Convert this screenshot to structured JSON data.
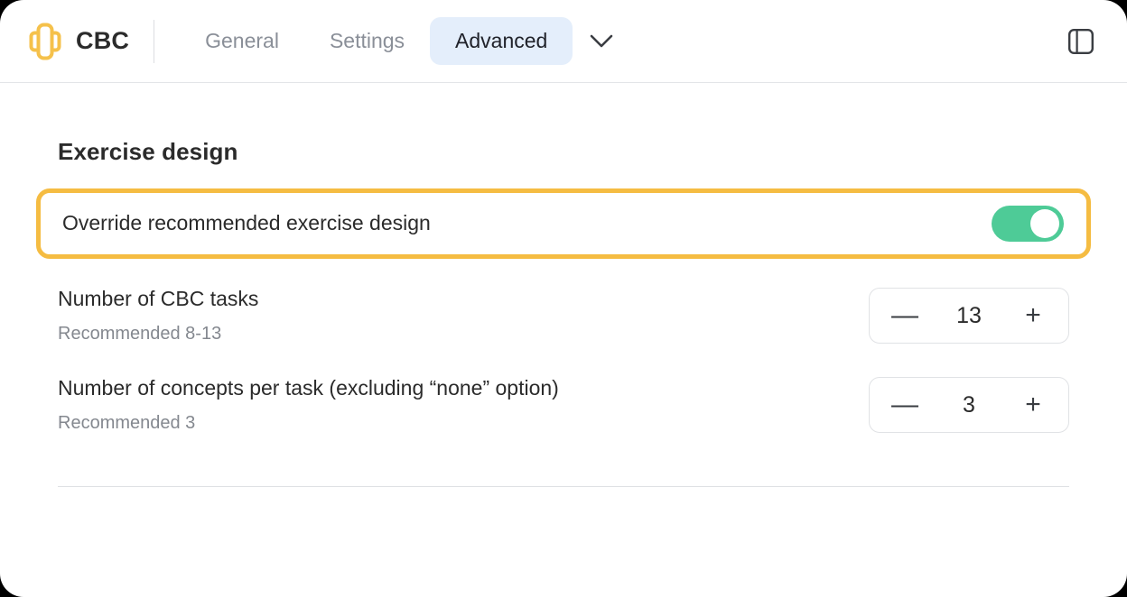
{
  "header": {
    "brand": {
      "name": "CBC",
      "logo_icon": "cbc-logo-icon",
      "logo_color": "#f5c14b"
    },
    "tabs": [
      {
        "label": "General",
        "active": false
      },
      {
        "label": "Settings",
        "active": false
      },
      {
        "label": "Advanced",
        "active": true
      }
    ],
    "dropdown_icon": "chevron-down-icon",
    "panel_toggle_icon": "sidebar-panel-icon",
    "active_tab_bg": "#e4eefb"
  },
  "main": {
    "section_title": "Exercise design",
    "override": {
      "label": "Override recommended exercise design",
      "toggle_state": "on",
      "toggle_color": "#4ecb97",
      "highlight_color": "#f5bc42"
    },
    "settings": [
      {
        "label": "Number of CBC tasks",
        "sub": "Recommended 8-13",
        "value": "13",
        "minus_label": "—",
        "plus_label": "+"
      },
      {
        "label": "Number of concepts per task (excluding “none” option)",
        "sub": "Recommended 3",
        "value": "3",
        "minus_label": "—",
        "plus_label": "+"
      }
    ]
  }
}
